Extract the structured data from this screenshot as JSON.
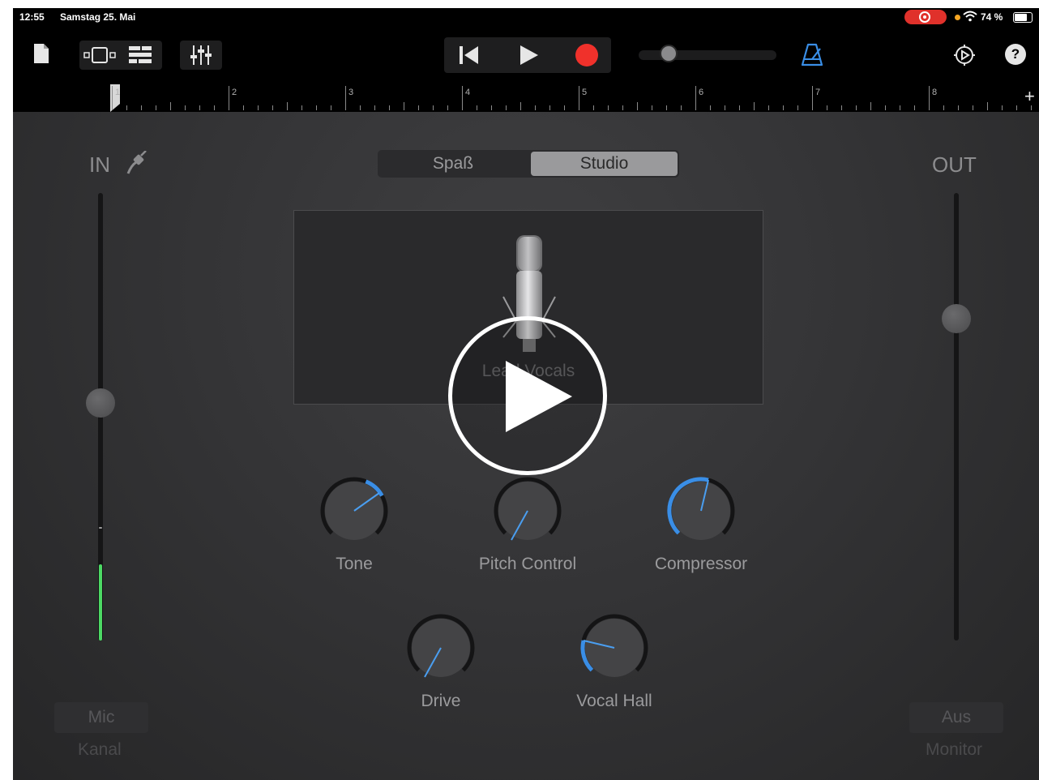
{
  "status": {
    "time": "12:55",
    "date": "Samstag 25. Mai",
    "battery": "74 %",
    "record_color": "#e0312b"
  },
  "toolbar": {
    "icons": [
      "document-icon",
      "tracks-view-icon",
      "list-view-icon",
      "mixer-icon",
      "rewind-icon",
      "play-icon",
      "record-icon",
      "metronome-icon",
      "settings-icon",
      "help-icon"
    ],
    "help_label": "?",
    "accent_color": "#3a8ee6"
  },
  "ruler": {
    "bars": [
      "1",
      "2",
      "3",
      "4",
      "5",
      "6",
      "7",
      "8"
    ],
    "add_label": "+"
  },
  "input": {
    "label": "IN",
    "channel_button": "Mic",
    "channel_label": "Kanal",
    "level": 0.53
  },
  "output": {
    "label": "OUT",
    "monitor_button": "Aus",
    "monitor_label": "Monitor",
    "level": 0.72
  },
  "mode": {
    "options": [
      "Spaß",
      "Studio"
    ],
    "selected": "Studio"
  },
  "preset": {
    "name": "Lead Vocals"
  },
  "knobs": {
    "tone": "Tone",
    "pitch": "Pitch Control",
    "compressor": "Compressor",
    "drive": "Drive",
    "hall": "Vocal Hall"
  }
}
